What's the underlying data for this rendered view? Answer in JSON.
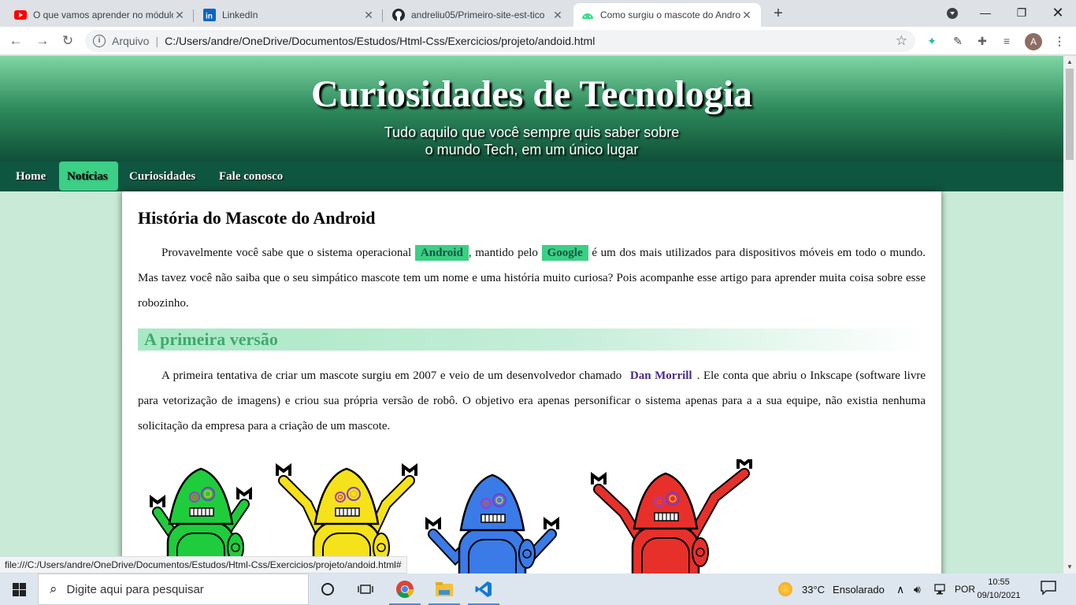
{
  "browser": {
    "tabs": [
      {
        "title": "O que vamos aprender no módulo",
        "icon": "youtube-icon"
      },
      {
        "title": "LinkedIn",
        "icon": "linkedin-icon"
      },
      {
        "title": "andreliu05/Primeiro-site-est-tico",
        "icon": "github-icon"
      },
      {
        "title": "Como surgiu o mascote do Andro",
        "icon": "android-icon",
        "active": true
      }
    ],
    "scheme": "Arquivo",
    "url": "C:/Users/andre/OneDrive/Documentos/Estudos/Html-Css/Exercicios/projeto/andoid.html",
    "profile_initial": "A",
    "status_url": "file:///C:/Users/andre/OneDrive/Documentos/Estudos/Html-Css/Exercicios/projeto/andoid.html#"
  },
  "site": {
    "title": "Curiosidades de Tecnologia",
    "subtitle_line1": "Tudo aquilo que você sempre quis saber sobre",
    "subtitle_line2": "o mundo Tech, em um único lugar",
    "nav": [
      {
        "label": "Home"
      },
      {
        "label": "Notícias",
        "active": true
      },
      {
        "label": "Curiosidades"
      },
      {
        "label": "Fale conosco"
      }
    ]
  },
  "article": {
    "heading": "História do Mascote do Android",
    "p1": {
      "t1": "Provavelmente você sabe que o sistema operacional ",
      "hl1": "Android",
      "t2": ", mantido pelo ",
      "hl2": "Google",
      "t3": " é um dos mais utilizados para dispositivos móveis em todo o mundo. Mas tavez você não saiba que o seu simpático mascote tem um nome e uma história muito curiosa? Pois acompanhe esse artigo para aprender muita coisa sobre esse robozinho."
    },
    "section_title": "A primeira versão",
    "p2": {
      "t1": "A primeira tentativa de criar um mascote surgiu em 2007 e veio de um desenvolvedor chamado ",
      "name": "Dan Morrill",
      "t2": ". Ele conta que abriu o Inkscape (software livre para vetorização de imagens) e criou sua própria versão de robô. O objetivo era apenas personificar o sistema apenas para a a sua equipe, não existia nenhuma solicitação da empresa para a criação de um mascote."
    },
    "robot_colors": [
      "#1fcc3c",
      "#f5e21a",
      "#3a7be8",
      "#e8302a"
    ]
  },
  "taskbar": {
    "search_placeholder": "Digite aqui para pesquisar",
    "weather_temp": "33°C",
    "weather_desc": "Ensolarado",
    "language": "POR",
    "time": "10:55",
    "date": "09/10/2021"
  },
  "colors": {
    "header_dark": "#0f5640",
    "accent_green": "#3ccf86",
    "page_bg": "#c8ead6"
  }
}
